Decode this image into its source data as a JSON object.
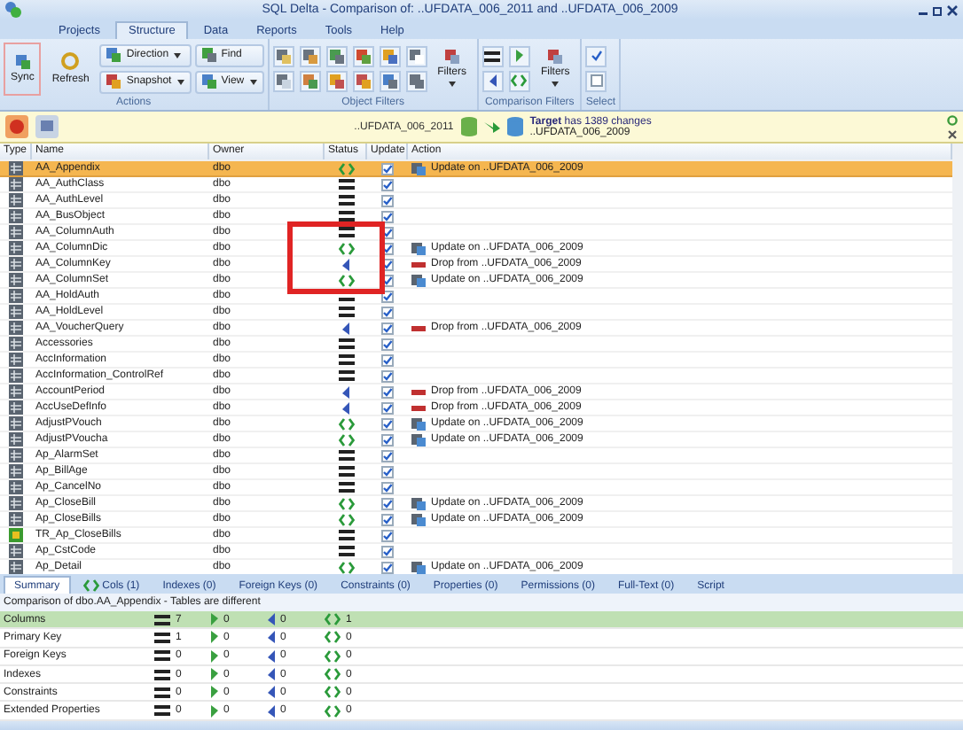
{
  "window": {
    "title": "SQL Delta - Comparison of: ..UFDATA_006_2011 and ..UFDATA_006_2009"
  },
  "menu_tabs": [
    {
      "label": "Projects",
      "selected": false
    },
    {
      "label": "Structure",
      "selected": true
    },
    {
      "label": "Data",
      "selected": false
    },
    {
      "label": "Reports",
      "selected": false
    },
    {
      "label": "Tools",
      "selected": false
    },
    {
      "label": "Help",
      "selected": false
    }
  ],
  "ribbon": {
    "sync": "Sync",
    "refresh": "Refresh",
    "direction": "Direction",
    "snapshot": "Snapshot",
    "find": "Find",
    "view": "View",
    "object_filters_button": "Filters",
    "comparison_filters_button": "Filters",
    "groups": [
      "Actions",
      "Object Filters",
      "Comparison Filters",
      "Select"
    ]
  },
  "compare_bar": {
    "source": "..UFDATA_006_2011",
    "target_info": "**Target** has 1389 changes",
    "target": "..UFDATA_006_2009"
  },
  "table": {
    "columns": [
      "Type",
      "Name",
      "Owner",
      "Status",
      "Update",
      "Action"
    ],
    "rows": [
      {
        "kind": "table",
        "name": "AA_Appendix",
        "owner": "dbo",
        "status": {
          "kind": "changed"
        },
        "update": true,
        "selected": true,
        "action": "Update on ..UFDATA_006_2009"
      },
      {
        "kind": "table",
        "name": "AA_AuthClass",
        "owner": "dbo",
        "status": {
          "kind": "same"
        },
        "update": true,
        "selected": false
      },
      {
        "kind": "table",
        "name": "AA_AuthLevel",
        "owner": "dbo",
        "status": {
          "kind": "same"
        },
        "update": true,
        "selected": false
      },
      {
        "kind": "table",
        "name": "AA_BusObject",
        "owner": "dbo",
        "status": {
          "kind": "same"
        },
        "update": true,
        "selected": false
      },
      {
        "kind": "table",
        "name": "AA_ColumnAuth",
        "owner": "dbo",
        "status": {
          "kind": "same"
        },
        "update": true,
        "selected": false
      },
      {
        "kind": "table",
        "name": "AA_ColumnDic",
        "owner": "dbo",
        "status": {
          "kind": "changed"
        },
        "update": true,
        "selected": false,
        "action": "Update on ..UFDATA_006_2009"
      },
      {
        "kind": "table",
        "name": "AA_ColumnKey",
        "owner": "dbo",
        "status": {
          "kind": "source_only"
        },
        "update": true,
        "selected": false,
        "action": "Drop from ..UFDATA_006_2009"
      },
      {
        "kind": "table",
        "name": "AA_ColumnSet",
        "owner": "dbo",
        "status": {
          "kind": "changed"
        },
        "update": true,
        "selected": false,
        "action": "Update on ..UFDATA_006_2009"
      },
      {
        "kind": "table",
        "name": "AA_HoldAuth",
        "owner": "dbo",
        "status": {
          "kind": "same"
        },
        "update": true,
        "selected": false
      },
      {
        "kind": "table",
        "name": "AA_HoldLevel",
        "owner": "dbo",
        "status": {
          "kind": "same"
        },
        "update": true,
        "selected": false
      },
      {
        "kind": "table",
        "name": "AA_VoucherQuery",
        "owner": "dbo",
        "status": {
          "kind": "source_only"
        },
        "update": true,
        "selected": false,
        "action": "Drop from ..UFDATA_006_2009"
      },
      {
        "kind": "table",
        "name": "Accessories",
        "owner": "dbo",
        "status": {
          "kind": "same"
        },
        "update": true,
        "selected": false
      },
      {
        "kind": "table",
        "name": "AccInformation",
        "owner": "dbo",
        "status": {
          "kind": "same"
        },
        "update": true,
        "selected": false
      },
      {
        "kind": "table",
        "name": "AccInformation_ControlRef",
        "owner": "dbo",
        "status": {
          "kind": "same"
        },
        "update": true,
        "selected": false
      },
      {
        "kind": "table",
        "name": "AccountPeriod",
        "owner": "dbo",
        "status": {
          "kind": "source_only"
        },
        "update": true,
        "selected": false,
        "action": "Drop from ..UFDATA_006_2009"
      },
      {
        "kind": "table",
        "name": "AccUseDefInfo",
        "owner": "dbo",
        "status": {
          "kind": "source_only"
        },
        "update": true,
        "selected": false,
        "action": "Drop from ..UFDATA_006_2009"
      },
      {
        "kind": "table",
        "name": "AdjustPVouch",
        "owner": "dbo",
        "status": {
          "kind": "changed"
        },
        "update": true,
        "selected": false,
        "action": "Update on ..UFDATA_006_2009"
      },
      {
        "kind": "table",
        "name": "AdjustPVoucha",
        "owner": "dbo",
        "status": {
          "kind": "changed"
        },
        "update": true,
        "selected": false,
        "action": "Update on ..UFDATA_006_2009"
      },
      {
        "kind": "table",
        "name": "Ap_AlarmSet",
        "owner": "dbo",
        "status": {
          "kind": "same"
        },
        "update": true,
        "selected": false
      },
      {
        "kind": "table",
        "name": "Ap_BillAge",
        "owner": "dbo",
        "status": {
          "kind": "same"
        },
        "update": true,
        "selected": false
      },
      {
        "kind": "table",
        "name": "Ap_CancelNo",
        "owner": "dbo",
        "status": {
          "kind": "same"
        },
        "update": true,
        "selected": false
      },
      {
        "kind": "table",
        "name": "Ap_CloseBill",
        "owner": "dbo",
        "status": {
          "kind": "changed"
        },
        "update": true,
        "selected": false,
        "action": "Update on ..UFDATA_006_2009"
      },
      {
        "kind": "table",
        "name": "Ap_CloseBills",
        "owner": "dbo",
        "status": {
          "kind": "changed"
        },
        "update": true,
        "selected": false,
        "action": "Update on ..UFDATA_006_2009"
      },
      {
        "kind": "trigger",
        "name": "TR_Ap_CloseBills",
        "owner": "dbo",
        "status": {
          "kind": "same"
        },
        "update": true,
        "selected": false
      },
      {
        "kind": "table",
        "name": "Ap_CstCode",
        "owner": "dbo",
        "status": {
          "kind": "same"
        },
        "update": true,
        "selected": false
      },
      {
        "kind": "table",
        "name": "Ap_Detail",
        "owner": "dbo",
        "status": {
          "kind": "changed"
        },
        "update": true,
        "selected": false,
        "action": "Update on ..UFDATA_006_2009"
      }
    ]
  },
  "detail_tabs": [
    {
      "label": "Summary",
      "selected": true
    },
    {
      "label": "Cols (1)",
      "selected": false,
      "icon": true
    },
    {
      "label": "Indexes (0)",
      "selected": false
    },
    {
      "label": "Foreign Keys (0)",
      "selected": false
    },
    {
      "label": "Constraints (0)",
      "selected": false
    },
    {
      "label": "Properties (0)",
      "selected": false
    },
    {
      "label": "Permissions (0)",
      "selected": false
    },
    {
      "label": "Full-Text (0)",
      "selected": false
    },
    {
      "label": "Script",
      "selected": false
    }
  ],
  "summary": {
    "caption": "Comparison of dbo.AA_Appendix - Tables are different",
    "rows": [
      {
        "name": "Columns",
        "selected": true,
        "same": "7",
        "new": "0",
        "dropped": "0",
        "changed": "1"
      },
      {
        "name": "Primary Key",
        "selected": false,
        "same": "1",
        "new": "0",
        "dropped": "0",
        "changed": "0"
      },
      {
        "name": "Foreign Keys",
        "selected": false,
        "same": "0",
        "new": "0",
        "dropped": "0",
        "changed": "0"
      },
      {
        "name": "Indexes",
        "selected": false,
        "same": "0",
        "new": "0",
        "dropped": "0",
        "changed": "0"
      },
      {
        "name": "Constraints",
        "selected": false,
        "same": "0",
        "new": "0",
        "dropped": "0",
        "changed": "0"
      },
      {
        "name": "Extended Properties",
        "selected": false,
        "same": "0",
        "new": "0",
        "dropped": "0",
        "changed": "0"
      }
    ]
  }
}
